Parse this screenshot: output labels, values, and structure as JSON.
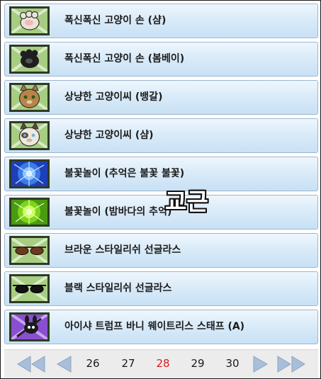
{
  "items": [
    {
      "label": "폭신폭신 고양이 손 (샴)",
      "icon": "cat-paw-siamese-icon"
    },
    {
      "label": "폭신폭신 고양이 손 (봄베이)",
      "icon": "cat-paw-bombay-icon"
    },
    {
      "label": "상냥한 고양이씨 (뱅갈)",
      "icon": "bengal-cat-face-icon"
    },
    {
      "label": "상냥한 고양이씨 (샴)",
      "icon": "siamese-cat-face-icon"
    },
    {
      "label": "불꽃놀이 (추억은 불꽃 불꽃)",
      "icon": "blue-firework-icon"
    },
    {
      "label": "불꽃놀이 (밤바다의 추억)",
      "icon": "green-firework-icon"
    },
    {
      "label": "브라운 스타일리쉬 선글라스",
      "icon": "brown-sunglasses-icon"
    },
    {
      "label": "블랙 스타일리쉬 선글라스",
      "icon": "black-sunglasses-icon"
    },
    {
      "label": "아이샤 트럼프 바니 웨이트리스 스태프 (A)",
      "icon": "bunny-staff-icon"
    }
  ],
  "pagination": {
    "pages": [
      "26",
      "27",
      "28",
      "29",
      "30"
    ],
    "current": "28"
  },
  "overlay_text": "교근",
  "colors": {
    "item_bg": "#d8eaf8",
    "item_border": "#9db6cf",
    "thumb_bg": "#9fc77d",
    "active_page": "#e01919",
    "pager_arrow": "#9fb6d2"
  }
}
